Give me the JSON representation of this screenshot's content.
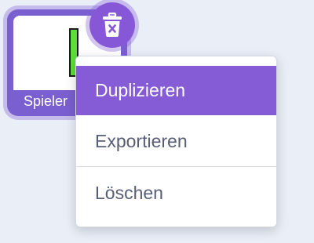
{
  "sprite": {
    "label": "Spieler",
    "costume_color": "#5fdc3d",
    "tile_color": "#7a5fd0"
  },
  "delete_button": {
    "icon": "trash-icon",
    "color": "#8658d8"
  },
  "context_menu": {
    "items": [
      {
        "label": "Duplizieren",
        "active": true
      },
      {
        "label": "Exportieren",
        "active": false
      },
      {
        "label": "Löschen",
        "active": false
      }
    ],
    "accent_color": "#855cd6",
    "text_color": "#575e75"
  }
}
